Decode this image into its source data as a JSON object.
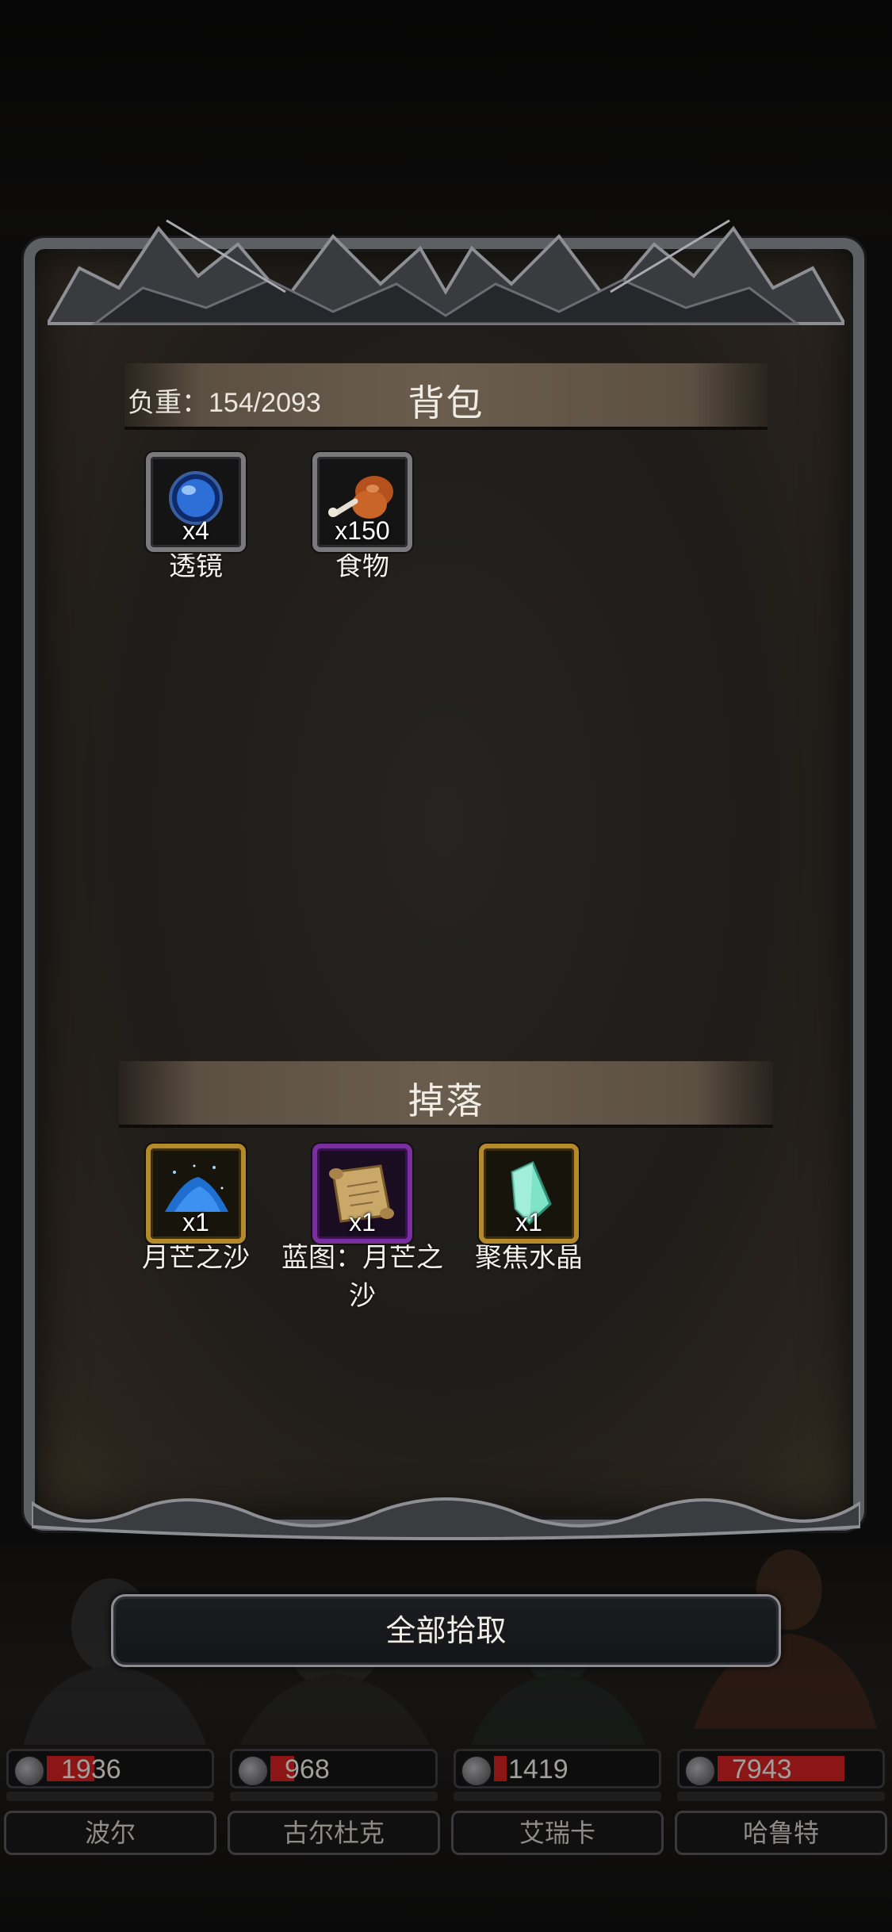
{
  "backpack": {
    "title": "背包",
    "weight_label": "负重：154/2093",
    "items": [
      {
        "name": "透镜",
        "count": "x4",
        "icon": "blue-lens-icon",
        "rarity_color": "#7a7a7c"
      },
      {
        "name": "食物",
        "count": "x150",
        "icon": "meat-drumstick-icon",
        "rarity_color": "#7a7a7c"
      }
    ]
  },
  "drops": {
    "title": "掉落",
    "items": [
      {
        "name": "月芒之沙",
        "count": "x1",
        "icon": "blue-sand-pile-icon",
        "rarity_color": "#b48a2a"
      },
      {
        "name": "蓝图：月芒之沙",
        "count": "x1",
        "icon": "blueprint-scroll-icon",
        "rarity_color": "#7a2ea0"
      },
      {
        "name": "聚焦水晶",
        "count": "x1",
        "icon": "crystal-shard-icon",
        "rarity_color": "#b48a2a"
      }
    ]
  },
  "collect_button": {
    "label": "全部拾取"
  },
  "characters": [
    {
      "name": "波尔",
      "hp": "1936"
    },
    {
      "name": "古尔杜克",
      "hp": "968"
    },
    {
      "name": "艾瑞卡",
      "hp": "1419"
    },
    {
      "name": "哈鲁特",
      "hp": "7943"
    }
  ],
  "colors": {
    "hp_fill": "#8c1515",
    "frame": "#5e5f63",
    "header": "#6a5d4d"
  }
}
